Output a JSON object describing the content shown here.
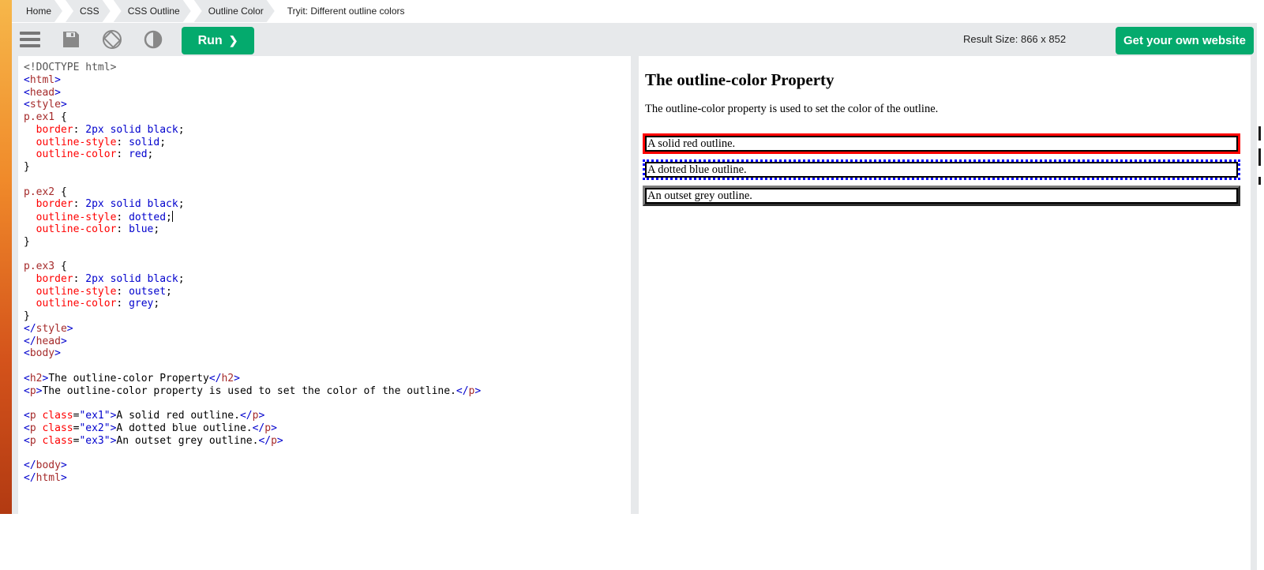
{
  "breadcrumb": {
    "items": [
      "Home",
      "CSS",
      "CSS Outline",
      "Outline Color"
    ],
    "current": "Tryit: Different outline colors"
  },
  "toolbar": {
    "run_label": "Run",
    "result_size": "Result Size: 866 x 852",
    "own_website_label": "Get your own website",
    "icons": [
      "menu-icon",
      "save-icon",
      "rotate-icon",
      "contrast-icon"
    ]
  },
  "code_lines": [
    "<!DOCTYPE html>",
    "<html>",
    "<head>",
    "<style>",
    "p.ex1 {",
    "  border: 2px solid black;",
    "  outline-style: solid;",
    "  outline-color: red;",
    "}",
    "",
    "p.ex2 {",
    "  border: 2px solid black;",
    "  outline-style: dotted;",
    "  outline-color: blue;",
    "}",
    "",
    "p.ex3 {",
    "  border: 2px solid black;",
    "  outline-style: outset;",
    "  outline-color: grey;",
    "}",
    "</style>",
    "</head>",
    "<body>",
    "",
    "<h2>The outline-color Property</h2>",
    "<p>The outline-color property is used to set the color of the outline.</p>",
    "",
    "<p class=\"ex1\">A solid red outline.</p>",
    "<p class=\"ex2\">A dotted blue outline.</p>",
    "<p class=\"ex3\">An outset grey outline.</p>",
    "",
    "</body>",
    "</html>"
  ],
  "result": {
    "heading": "The outline-color Property",
    "intro": "The outline-color property is used to set the color of the outline.",
    "ex1": "A solid red outline.",
    "ex2": "A dotted blue outline.",
    "ex3": "An outset grey outline."
  },
  "colors": {
    "accent": "#04aa6d",
    "toolbar_bg": "#e7e9eb",
    "outline_red": "#ff0000",
    "outline_blue": "#0000ff",
    "outline_grey": "#808080"
  }
}
